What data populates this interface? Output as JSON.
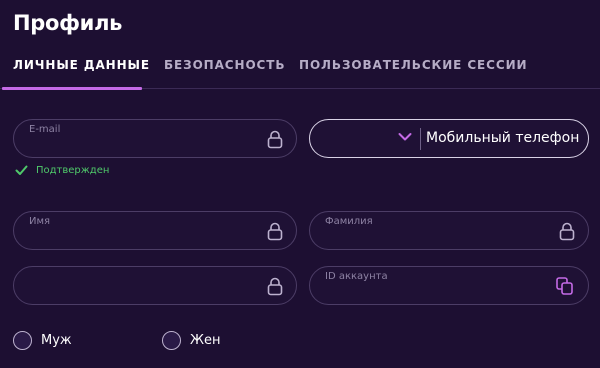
{
  "page": {
    "title": "Профиль"
  },
  "tabs": [
    {
      "label": "ЛИЧНЫЕ ДАННЫЕ",
      "active": true
    },
    {
      "label": "БЕЗОПАСНОСТЬ",
      "active": false
    },
    {
      "label": "ПОЛЬЗОВАТЕЛЬСКИЕ СЕССИИ",
      "active": false
    }
  ],
  "fields": {
    "email": {
      "label": "E-mail",
      "value": "",
      "locked": true
    },
    "phone": {
      "label": "Мобильный телефон"
    },
    "first_name": {
      "label": "Имя",
      "value": "",
      "locked": true
    },
    "last_name": {
      "label": "Фамилия",
      "value": "",
      "locked": true
    },
    "unlabeled": {
      "label": "",
      "value": "",
      "locked": true
    },
    "account_id": {
      "label": "ID аккаунта",
      "value": ""
    }
  },
  "email_status": {
    "text": "Подтвержден"
  },
  "gender": {
    "options": [
      {
        "label": "Муж",
        "selected": false
      },
      {
        "label": "Жен",
        "selected": false
      }
    ]
  },
  "colors": {
    "background": "#1d0f32",
    "accent": "#c46ae6",
    "verified": "#4fc96a"
  },
  "icons": {
    "lock": "lock-icon",
    "chevron": "chevron-down-icon",
    "copy": "copy-icon",
    "check": "check-icon"
  }
}
